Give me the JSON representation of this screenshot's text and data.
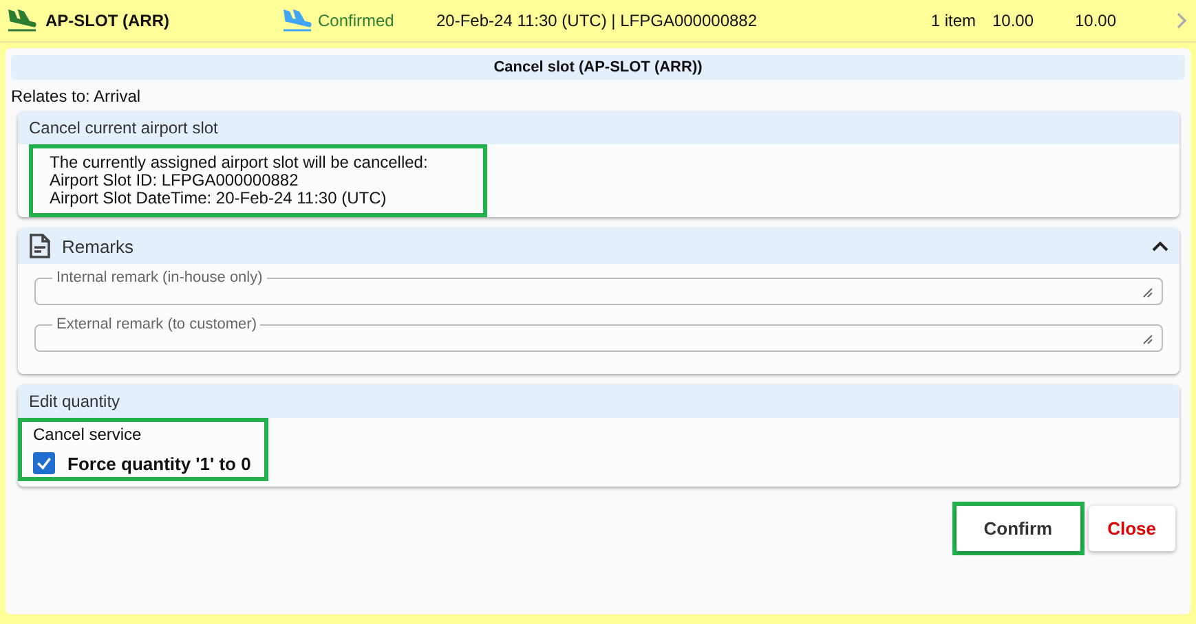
{
  "service_row": {
    "code": "AP-SLOT (ARR)",
    "status": "Confirmed",
    "detail": "20-Feb-24 11:30 (UTC) | LFPGA000000882",
    "quantity": "1 item",
    "price": "10.00",
    "total": "10.00"
  },
  "dialog": {
    "title": "Cancel slot (AP-SLOT (ARR))",
    "relates_to": "Relates to: Arrival",
    "cancel_section": {
      "title": "Cancel current airport slot",
      "highlighted": true,
      "lines": [
        "The currently assigned airport slot will be cancelled:",
        "Airport Slot ID: LFPGA000000882",
        "Airport Slot DateTime: 20-Feb-24 11:30 (UTC)"
      ]
    },
    "remarks": {
      "title": "Remarks",
      "expanded": true,
      "fields": [
        {
          "label": "Internal remark (in-house only)"
        },
        {
          "label": "External remark (to customer)"
        }
      ]
    },
    "quantity_section": {
      "title": "Edit quantity",
      "highlighted": true,
      "subtitle": "Cancel service",
      "checkbox": {
        "label": "Force quantity '1' to 0",
        "checked": true
      }
    },
    "buttons": [
      {
        "label": "Confirm",
        "kind": "primary",
        "highlighted": true
      },
      {
        "label": "Close",
        "kind": "danger",
        "highlighted": false
      }
    ]
  }
}
